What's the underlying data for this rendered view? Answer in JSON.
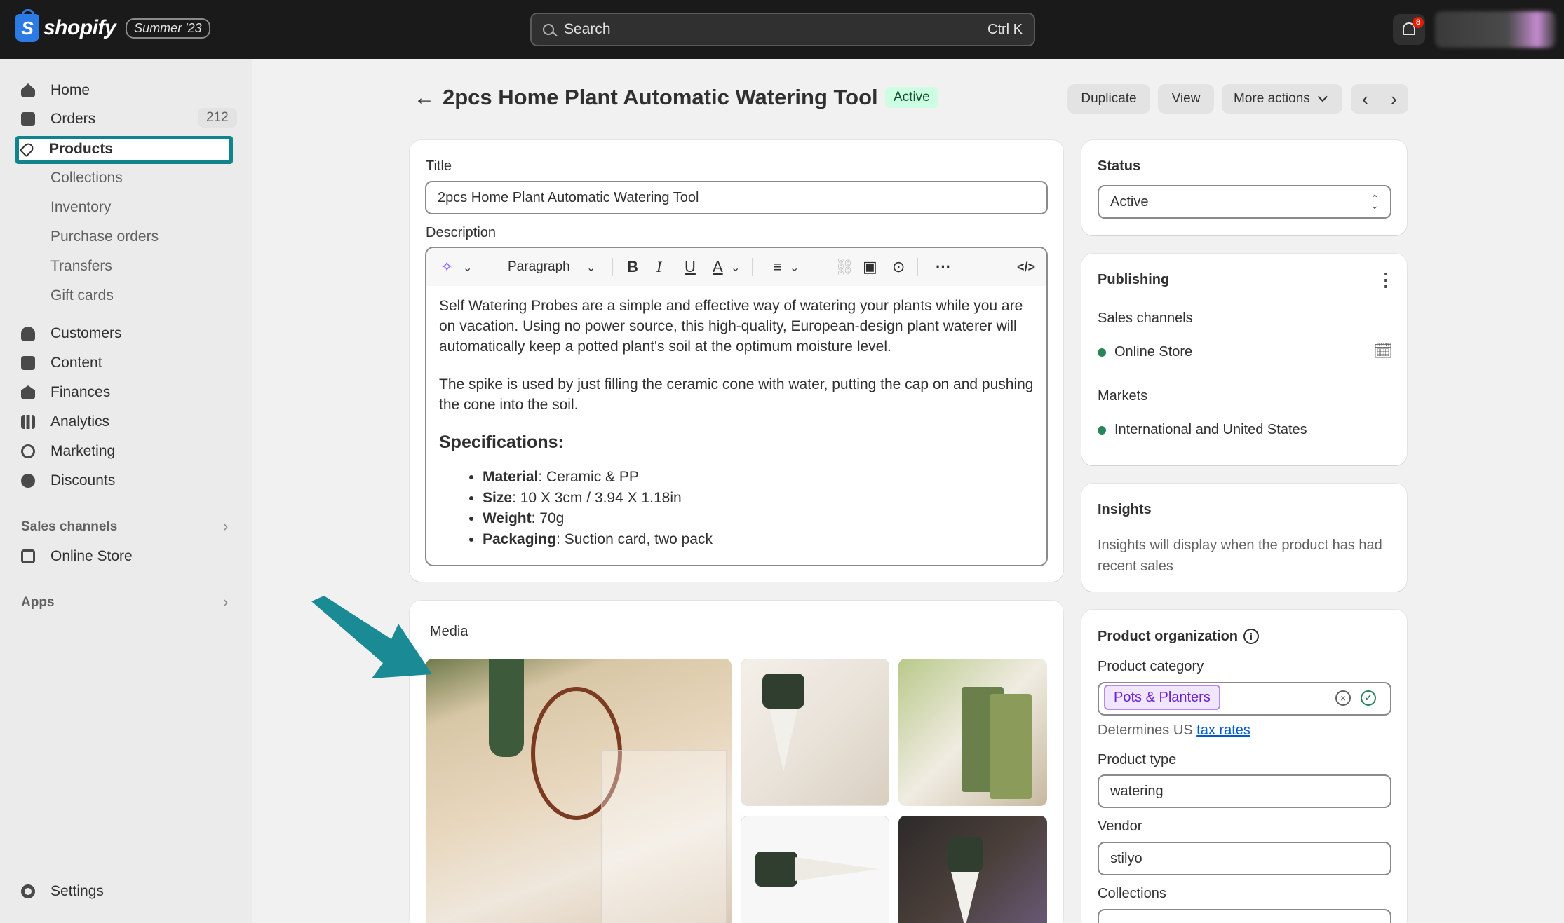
{
  "topbar": {
    "logo_text": "shopify",
    "logo_mark": "S",
    "edition_badge": "Summer '23",
    "search_placeholder": "Search",
    "search_shortcut": "Ctrl K",
    "notification_count": "8"
  },
  "sidebar": {
    "items": [
      {
        "label": "Home",
        "icon": "home-icon"
      },
      {
        "label": "Orders",
        "icon": "orders-icon",
        "count": "212"
      },
      {
        "label": "Products",
        "icon": "tag-icon"
      },
      {
        "label": "Customers",
        "icon": "person-icon"
      },
      {
        "label": "Content",
        "icon": "image-icon"
      },
      {
        "label": "Finances",
        "icon": "bank-icon"
      },
      {
        "label": "Analytics",
        "icon": "bar-chart-icon"
      },
      {
        "label": "Marketing",
        "icon": "target-icon"
      },
      {
        "label": "Discounts",
        "icon": "discount-icon"
      }
    ],
    "product_subitems": [
      "Collections",
      "Inventory",
      "Purchase orders",
      "Transfers",
      "Gift cards"
    ],
    "sales_channels_label": "Sales channels",
    "online_store_label": "Online Store",
    "apps_label": "Apps",
    "settings_label": "Settings"
  },
  "header": {
    "back_icon": "arrow-left-icon",
    "title": "2pcs Home Plant Automatic Watering Tool",
    "status": "Active",
    "duplicate_label": "Duplicate",
    "view_label": "View",
    "more_actions_label": "More actions"
  },
  "product_form": {
    "title_label": "Title",
    "title_value": "2pcs Home Plant Automatic Watering Tool",
    "description_label": "Description",
    "paragraph_style": "Paragraph",
    "description_p1": "Self Watering Probes are a simple and effective way of watering your plants while you are on vacation. Using no power source, this high-quality, European-design plant waterer will automatically keep a potted plant's soil at the optimum moisture level.",
    "description_p2": "The spike is used by just filling the ceramic cone with water, putting the cap on and pushing the cone into the soil.",
    "specifications_heading": "Specifications:",
    "specs": [
      {
        "key": "Material",
        "value": ": Ceramic & PP"
      },
      {
        "key": "Size",
        "value": ": 10 X 3cm / 3.94 X 1.18in"
      },
      {
        "key": "Weight",
        "value": ": 70g"
      },
      {
        "key": "Packaging",
        "value": ": Suction card, two pack"
      }
    ]
  },
  "media": {
    "label": "Media"
  },
  "status_card": {
    "label": "Status",
    "value": "Active"
  },
  "publishing": {
    "label": "Publishing",
    "sales_channels_label": "Sales channels",
    "channel": "Online Store",
    "markets_label": "Markets",
    "market": "International and United States"
  },
  "insights": {
    "label": "Insights",
    "text": "Insights will display when the product has had recent sales"
  },
  "organization": {
    "label": "Product organization",
    "category_label": "Product category",
    "category_value": "Pots & Planters",
    "tax_prefix": "Determines US",
    "tax_link": "tax rates",
    "type_label": "Product type",
    "type_value": "watering",
    "vendor_label": "Vendor",
    "vendor_value": "stilyo",
    "collections_label": "Collections"
  },
  "colors": {
    "highlight": "#10838d",
    "active_badge_bg": "#cdfee1",
    "link": "#005bd3"
  }
}
